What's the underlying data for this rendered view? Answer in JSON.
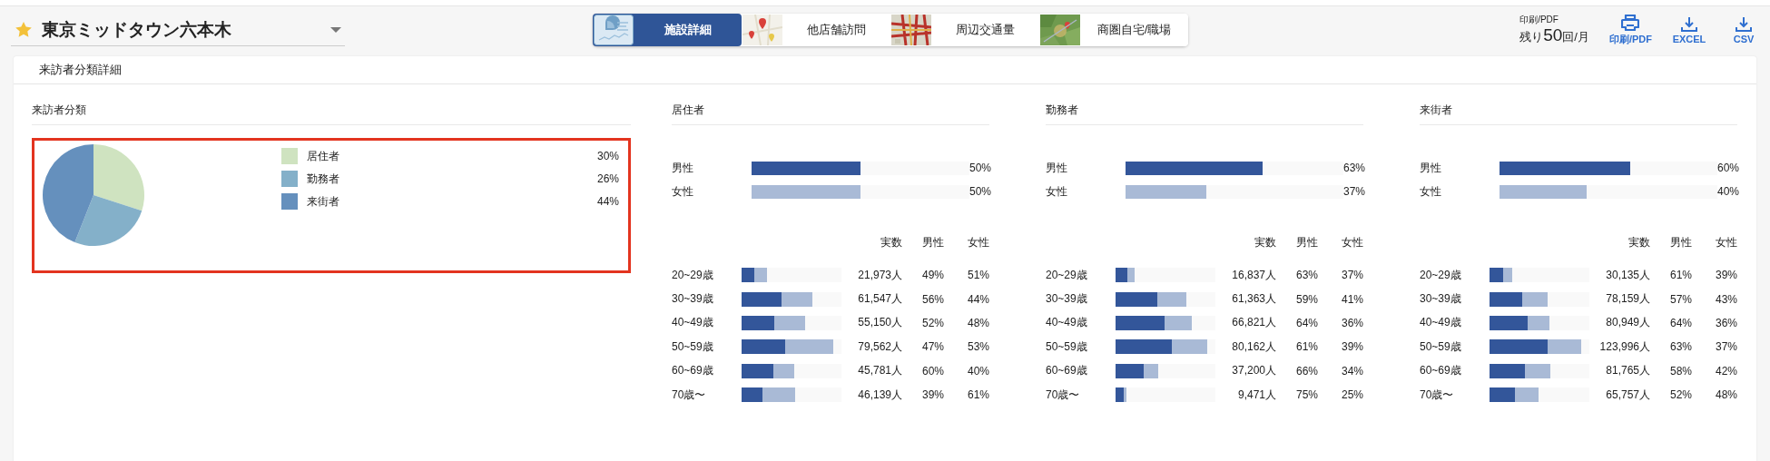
{
  "location": {
    "name": "東京ミッドタウン六本木",
    "starred": true
  },
  "tabs": [
    {
      "label": "施設詳細",
      "kind": "chart",
      "selected": true
    },
    {
      "label": "他店舗訪問",
      "kind": "pins",
      "selected": false
    },
    {
      "label": "周辺交通量",
      "kind": "traffic",
      "selected": false
    },
    {
      "label": "商圏自宅/職場",
      "kind": "area",
      "selected": false
    }
  ],
  "print_quota": {
    "label": "印刷/PDF",
    "prefix": "残り",
    "count": "50",
    "suffix": "回/月"
  },
  "actions": [
    {
      "kind": "print",
      "label": "印刷/PDF"
    },
    {
      "kind": "download",
      "label": "EXCEL"
    },
    {
      "kind": "download",
      "label": "CSV"
    }
  ],
  "card": {
    "title": "来訪者分類詳細"
  },
  "classification": {
    "title": "来訪者分類",
    "highlighted": true,
    "chart_data": {
      "type": "pie",
      "categories": [
        "居住者",
        "勤務者",
        "来街者"
      ],
      "values": [
        30,
        26,
        44
      ]
    },
    "legend": [
      {
        "value": "30%",
        "color": "#cfe3c0"
      },
      {
        "value": "26%",
        "color": "#84b0c9"
      },
      {
        "value": "44%",
        "color": "#6590bd"
      }
    ]
  },
  "segments": [
    {
      "title": "居住者",
      "gender": [
        {
          "label": "男性",
          "kind": "male",
          "level": 0.5,
          "value": "50%"
        },
        {
          "label": "女性",
          "kind": "female",
          "level": 0.5,
          "value": "50%"
        }
      ],
      "columns": [
        "実数",
        "男性",
        "女性"
      ],
      "rows": [
        {
          "age": "20~29歳",
          "count": "21,973人",
          "male": "49%",
          "female": "51%",
          "bar": [
            {
              "kind": "total",
              "level": 0.254
            },
            {
              "kind": "male",
              "level": 0.124
            }
          ]
        },
        {
          "age": "30~39歳",
          "count": "61,547人",
          "male": "56%",
          "female": "44%",
          "bar": [
            {
              "kind": "total",
              "level": 0.712
            },
            {
              "kind": "male",
              "level": 0.398
            }
          ]
        },
        {
          "age": "40~49歳",
          "count": "55,150人",
          "male": "52%",
          "female": "48%",
          "bar": [
            {
              "kind": "total",
              "level": 0.638
            },
            {
              "kind": "male",
              "level": 0.331
            }
          ]
        },
        {
          "age": "50~59歳",
          "count": "79,562人",
          "male": "47%",
          "female": "53%",
          "bar": [
            {
              "kind": "total",
              "level": 0.92
            },
            {
              "kind": "male",
              "level": 0.432
            }
          ]
        },
        {
          "age": "60~69歳",
          "count": "45,781人",
          "male": "60%",
          "female": "40%",
          "bar": [
            {
              "kind": "total",
              "level": 0.529
            },
            {
              "kind": "male",
              "level": 0.317
            }
          ]
        },
        {
          "age": "70歳〜",
          "count": "46,139人",
          "male": "39%",
          "female": "61%",
          "bar": [
            {
              "kind": "total",
              "level": 0.534
            },
            {
              "kind": "male",
              "level": 0.208
            }
          ]
        }
      ]
    },
    {
      "title": "勤務者",
      "gender": [
        {
          "label": "男性",
          "kind": "male",
          "level": 0.63,
          "value": "63%"
        },
        {
          "label": "女性",
          "kind": "female",
          "level": 0.37,
          "value": "37%"
        }
      ],
      "columns": [
        "実数",
        "男性",
        "女性"
      ],
      "rows": [
        {
          "age": "20~29歳",
          "count": "16,837人",
          "male": "63%",
          "female": "37%",
          "bar": [
            {
              "kind": "total",
              "level": 0.193
            },
            {
              "kind": "male",
              "level": 0.121
            }
          ]
        },
        {
          "age": "30~39歳",
          "count": "61,363人",
          "male": "59%",
          "female": "41%",
          "bar": [
            {
              "kind": "total",
              "level": 0.705
            },
            {
              "kind": "male",
              "level": 0.416
            }
          ]
        },
        {
          "age": "40~49歳",
          "count": "66,821人",
          "male": "64%",
          "female": "36%",
          "bar": [
            {
              "kind": "total",
              "level": 0.766
            },
            {
              "kind": "male",
              "level": 0.49
            }
          ]
        },
        {
          "age": "50~59歳",
          "count": "80,162人",
          "male": "61%",
          "female": "39%",
          "bar": [
            {
              "kind": "total",
              "level": 0.92
            },
            {
              "kind": "male",
              "level": 0.561
            }
          ]
        },
        {
          "age": "60~69歳",
          "count": "37,200人",
          "male": "66%",
          "female": "34%",
          "bar": [
            {
              "kind": "total",
              "level": 0.427
            },
            {
              "kind": "male",
              "level": 0.282
            }
          ]
        },
        {
          "age": "70歳〜",
          "count": "9,471人",
          "male": "75%",
          "female": "25%",
          "bar": [
            {
              "kind": "total",
              "level": 0.109
            },
            {
              "kind": "male",
              "level": 0.082
            }
          ]
        }
      ]
    },
    {
      "title": "来街者",
      "gender": [
        {
          "label": "男性",
          "kind": "male",
          "level": 0.6,
          "value": "60%"
        },
        {
          "label": "女性",
          "kind": "female",
          "level": 0.4,
          "value": "40%"
        }
      ],
      "columns": [
        "実数",
        "男性",
        "女性"
      ],
      "rows": [
        {
          "age": "20~29歳",
          "count": "30,135人",
          "male": "61%",
          "female": "39%",
          "bar": [
            {
              "kind": "total",
              "level": 0.224
            },
            {
              "kind": "male",
              "level": 0.136
            }
          ]
        },
        {
          "age": "30~39歳",
          "count": "78,159人",
          "male": "57%",
          "female": "43%",
          "bar": [
            {
              "kind": "total",
              "level": 0.58
            },
            {
              "kind": "male",
              "level": 0.33
            }
          ]
        },
        {
          "age": "40~49歳",
          "count": "80,949人",
          "male": "64%",
          "female": "36%",
          "bar": [
            {
              "kind": "total",
              "level": 0.601
            },
            {
              "kind": "male",
              "level": 0.385
            }
          ]
        },
        {
          "age": "50~59歳",
          "count": "123,996人",
          "male": "63%",
          "female": "37%",
          "bar": [
            {
              "kind": "total",
              "level": 0.92
            },
            {
              "kind": "male",
              "level": 0.58
            }
          ]
        },
        {
          "age": "60~69歳",
          "count": "81,765人",
          "male": "58%",
          "female": "42%",
          "bar": [
            {
              "kind": "total",
              "level": 0.606
            },
            {
              "kind": "male",
              "level": 0.351
            }
          ]
        },
        {
          "age": "70歳〜",
          "count": "65,757人",
          "male": "52%",
          "female": "48%",
          "bar": [
            {
              "kind": "total",
              "level": 0.488
            },
            {
              "kind": "male",
              "level": 0.254
            }
          ]
        }
      ]
    }
  ]
}
